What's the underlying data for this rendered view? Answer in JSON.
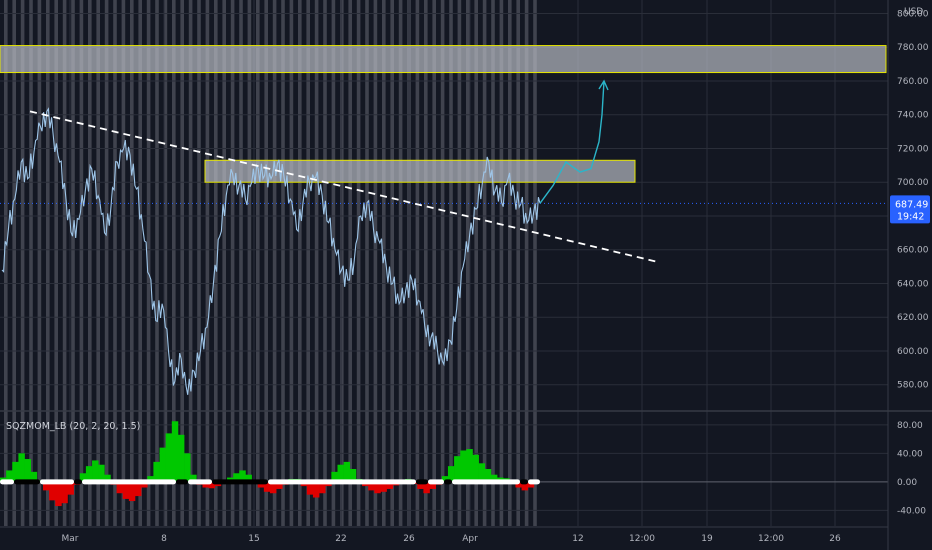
{
  "currency_label": "USD",
  "price_badge": {
    "value": "687.49",
    "countdown": "19:42",
    "color": "#2962ff"
  },
  "indicator_label": "SQZMOM_LB (20, 2, 20, 1.5)",
  "colors": {
    "background": "#131722",
    "price_line": "#9ec5e8",
    "squeeze_bands": "#787b86",
    "zone_border": "#e6e600",
    "zone_fill": "#b2b5be",
    "trendline": "#ffffff",
    "projection": "#2bb5c9",
    "momentum_up": "#00c800",
    "momentum_down": "#e00000",
    "squeeze_on": "#000000",
    "squeeze_off": "#ffffff"
  },
  "chart_data": [
    {
      "type": "line",
      "title": "",
      "x_ticks": [
        "Mar",
        "8",
        "15",
        "22",
        "26",
        "Apr",
        "12",
        "12:00",
        "19",
        "12:00",
        "26"
      ],
      "y_ticks": [
        "580.00",
        "600.00",
        "620.00",
        "640.00",
        "660.00",
        "680.00",
        "700.00",
        "720.00",
        "740.00",
        "760.00",
        "780.00",
        "800.00"
      ],
      "ylim": [
        565,
        808
      ],
      "grid": true,
      "last_price": 687.49,
      "series": [
        {
          "values": [
            648,
            672,
            690,
            712,
            702,
            718,
            733,
            742,
            728,
            712,
            690,
            668,
            678,
            695,
            708,
            692,
            670,
            685,
            712,
            720,
            716,
            696,
            672,
            645,
            618,
            628,
            600,
            582,
            595,
            574,
            588,
            600,
            614,
            640,
            668,
            692,
            705,
            698,
            690,
            700,
            708,
            704,
            702,
            711,
            704,
            690,
            672,
            688,
            700,
            703,
            692,
            676,
            660,
            648,
            642,
            654,
            680,
            688,
            672,
            664,
            650,
            640,
            628,
            635,
            642,
            630,
            615,
            608,
            600,
            592,
            606,
            625,
            650,
            668,
            684,
            700,
            712,
            695,
            688,
            702,
            692,
            687,
            676,
            682,
            687.49
          ]
        }
      ],
      "trendline": {
        "from": 742,
        "to": 653,
        "style": "dashed"
      },
      "zones": [
        {
          "low": 765,
          "high": 781
        },
        {
          "low": 700,
          "high": 713
        }
      ],
      "projection": [
        687.49,
        698,
        712,
        706,
        708,
        724,
        740,
        760
      ]
    },
    {
      "type": "bar",
      "title": "SQZMOM_LB (20, 2, 20, 1.5)",
      "y_ticks": [
        "-40.00",
        "0.00",
        "40.00",
        "80.00"
      ],
      "ylim": [
        -62,
        98
      ],
      "values": [
        6,
        16,
        28,
        40,
        32,
        14,
        2,
        -12,
        -26,
        -34,
        -30,
        -18,
        -4,
        12,
        22,
        30,
        24,
        10,
        -4,
        -16,
        -24,
        -27,
        -20,
        -8,
        8,
        28,
        48,
        68,
        85,
        66,
        40,
        10,
        -4,
        -8,
        -9,
        -6,
        -2,
        6,
        12,
        16,
        10,
        2,
        -8,
        -14,
        -16,
        -10,
        -4,
        4,
        4,
        -6,
        -18,
        -22,
        -16,
        -6,
        14,
        24,
        28,
        18,
        4,
        -6,
        -12,
        -16,
        -14,
        -10,
        -5,
        2,
        4,
        -3,
        -10,
        -16,
        -10,
        -4,
        8,
        22,
        36,
        44,
        46,
        38,
        26,
        18,
        10,
        6,
        5,
        -2,
        -8,
        -12,
        -8,
        0
      ]
    }
  ]
}
